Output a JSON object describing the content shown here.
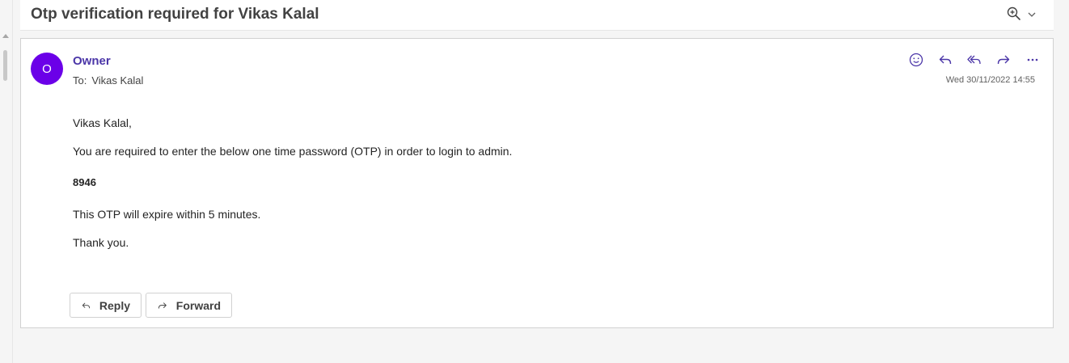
{
  "subject": "Otp verification required for Vikas Kalal",
  "sender": {
    "avatar_initial": "O",
    "name": "Owner",
    "to_label": "To:",
    "to_name": "Vikas Kalal",
    "timestamp": "Wed 30/11/2022 14:55"
  },
  "body": {
    "greeting": "Vikas Kalal,",
    "line1": "You are required to enter the below one time password (OTP) in order to login to admin.",
    "otp": "8946",
    "line2": "This OTP will expire within 5 minutes.",
    "thanks": "Thank you."
  },
  "buttons": {
    "reply": "Reply",
    "forward": "Forward"
  },
  "icons": {
    "header": [
      "zoom-in-icon",
      "chevron-down-icon"
    ],
    "actions": [
      "emoji-icon",
      "reply-icon",
      "reply-all-icon",
      "forward-icon",
      "more-icon"
    ]
  },
  "colors": {
    "accent": "#4b36a8",
    "avatar": "#6b00e8"
  }
}
